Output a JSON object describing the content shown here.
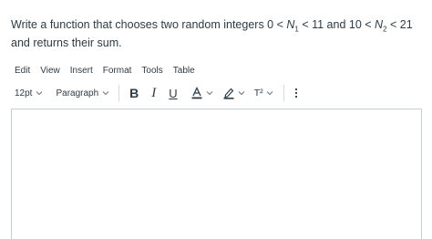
{
  "question": {
    "text_before_n1": "Write a function that chooses two random integers 0 < ",
    "n1_var": "N",
    "n1_sub": "1",
    "text_between": " < 11 and 10 < ",
    "n2_var": "N",
    "n2_sub": "2",
    "text_after_n2": " < 21 and returns their sum."
  },
  "menubar": {
    "edit": "Edit",
    "view": "View",
    "insert": "Insert",
    "format": "Format",
    "tools": "Tools",
    "table": "Table"
  },
  "toolbar": {
    "font_size": "12pt",
    "block_format": "Paragraph",
    "superscript_label": "T²",
    "icons": [
      "chevron-down-icon",
      "bold-icon",
      "italic-icon",
      "underline-icon",
      "text-color-icon",
      "highlight-icon",
      "superscript-icon",
      "more-options-icon"
    ]
  },
  "editor": {
    "content": ""
  },
  "colors": {
    "text": "#2d3b45",
    "border": "#c7cdd1",
    "separator": "#d7dadd"
  }
}
